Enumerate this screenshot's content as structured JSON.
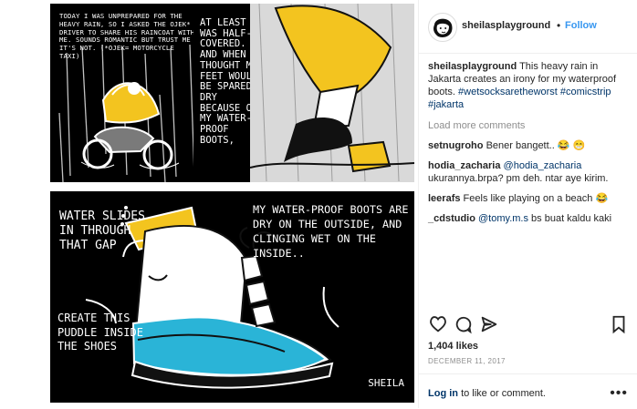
{
  "post": {
    "comic": {
      "panel1_text": "TODAY I WAS UNPREPARED FOR THE HEAVY RAIN, SO I ASKED THE OJEK* DRIVER TO SHARE HIS RAINCOAT WITH ME. SOUNDS ROMANTIC BUT TRUST ME IT'S NOT. (*OJEK= MOTORCYCLE TAXI)",
      "panel2_text": "AT LEAST I WAS HALF-COVERED. AND WHEN I THOUGHT MY FEET WOULD BE SPARED DRY BECAUSE OF MY WATER-PROOF BOOTS,",
      "panel4_left_text": "WATER SLIDES IN THROUGH THAT GAP",
      "panel4_bottom_text": "CREATE THIS PUDDLE INSIDE THE SHOES",
      "panel4_right_text": "MY WATER-PROOF BOOTS ARE DRY ON THE OUTSIDE, AND CLINGING WET ON THE INSIDE..",
      "signature": "SHEILA"
    },
    "sidebar": {
      "username": "sheilasplayground",
      "follow_label": "Follow",
      "caption_user": "sheilasplayground",
      "caption_text": "This heavy rain in Jakarta creates an irony for my waterproof boots.",
      "hashtags": "#wetsocksaretheworst #comicstrip #jakarta",
      "load_more": "Load more comments",
      "comments": [
        {
          "user": "setnugroho",
          "text": "Bener bangett.. 😂 😁"
        },
        {
          "user": "hodia_zacharia",
          "mention": "@hodia_zacharia",
          "text": "ukurannya.brpa? pm deh. ntar aye kirim."
        },
        {
          "user": "leerafs",
          "text": "Feels like playing on a beach 😂"
        },
        {
          "user": "_cdstudio",
          "mention": "@tomy.m.s",
          "text": "bs buat kaldu kaki"
        }
      ],
      "likes": "1,404 likes",
      "date": "DECEMBER 11, 2017",
      "login_link": "Log in",
      "login_text": "to like or comment."
    },
    "colors": {
      "brand_blue": "#3897f0",
      "text": "#262626",
      "muted": "#8e8e8e",
      "comic_yellow": "#f3c41f",
      "comic_cyan": "#2ab4d7"
    }
  }
}
